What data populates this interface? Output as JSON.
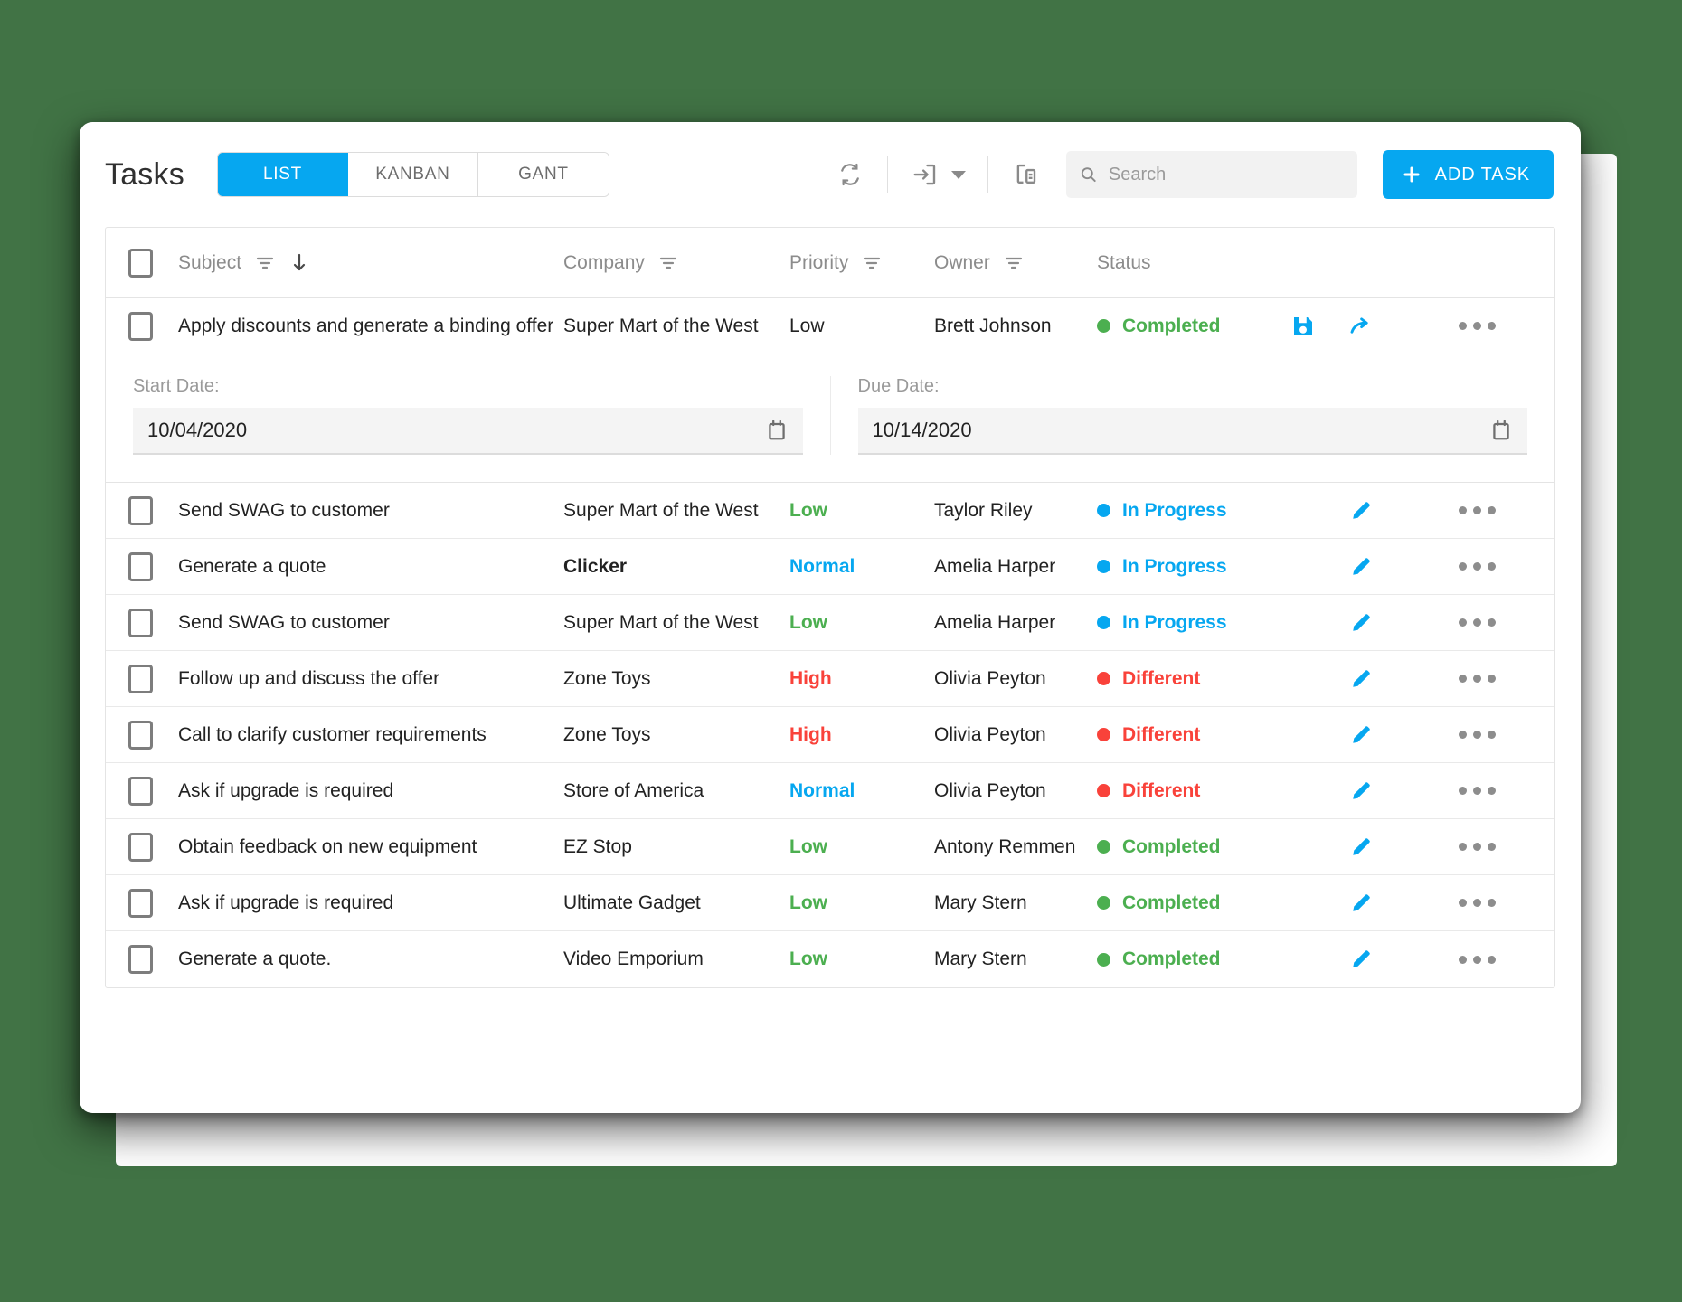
{
  "header": {
    "title": "Tasks",
    "views": [
      {
        "label": "LIST",
        "active": true
      },
      {
        "label": "KANBAN",
        "active": false
      },
      {
        "label": "GANT",
        "active": false
      }
    ],
    "actions": {
      "refresh_icon": "refresh-icon",
      "import_icon": "import-icon",
      "import_caret_icon": "chevron-down-icon",
      "document_icon": "document-settings-icon"
    },
    "search": {
      "placeholder": "Search",
      "value": "",
      "icon": "search-icon"
    },
    "add_task": {
      "label": "ADD TASK",
      "icon": "plus-icon"
    }
  },
  "grid": {
    "columns": [
      {
        "key": "subject",
        "label": "Subject",
        "filter": true,
        "sort": "desc"
      },
      {
        "key": "company",
        "label": "Company",
        "filter": true,
        "sort": null
      },
      {
        "key": "priority",
        "label": "Priority",
        "filter": true,
        "sort": null
      },
      {
        "key": "owner",
        "label": "Owner",
        "filter": true,
        "sort": null
      },
      {
        "key": "status",
        "label": "Status",
        "filter": false,
        "sort": null
      }
    ],
    "edit_panel": {
      "start_date": {
        "label": "Start Date:",
        "value": "10/04/2020"
      },
      "due_date": {
        "label": "Due Date:",
        "value": "10/14/2020"
      }
    },
    "rows": [
      {
        "subject": "Apply discounts and generate a binding offer",
        "company": "Super Mart of the West",
        "company_bold": false,
        "priority": "Low",
        "priority_color": "#222222",
        "priority_plain": true,
        "owner": "Brett Johnson",
        "status": "Completed",
        "status_color": "#4caf50",
        "editing": true
      },
      {
        "subject": "Send SWAG to customer",
        "company": "Super Mart of the West",
        "company_bold": false,
        "priority": "Low",
        "priority_color": "#4caf50",
        "priority_plain": false,
        "owner": "Taylor Riley",
        "status": "In Progress",
        "status_color": "#06a7f0",
        "editing": false
      },
      {
        "subject": "Generate a quote",
        "company": "Clicker",
        "company_bold": true,
        "priority": "Normal",
        "priority_color": "#06a7f0",
        "priority_plain": false,
        "owner": "Amelia Harper",
        "status": "In Progress",
        "status_color": "#06a7f0",
        "editing": false
      },
      {
        "subject": "Send SWAG to customer",
        "company": "Super Mart of the West",
        "company_bold": false,
        "priority": "Low",
        "priority_color": "#4caf50",
        "priority_plain": false,
        "owner": "Amelia Harper",
        "status": "In Progress",
        "status_color": "#06a7f0",
        "editing": false
      },
      {
        "subject": "Follow up and discuss the offer",
        "company": "Zone Toys",
        "company_bold": false,
        "priority": "High",
        "priority_color": "#f9423a",
        "priority_plain": false,
        "owner": "Olivia Peyton",
        "status": "Different",
        "status_color": "#f9423a",
        "editing": false
      },
      {
        "subject": "Call to clarify customer requirements",
        "company": "Zone Toys",
        "company_bold": false,
        "priority": "High",
        "priority_color": "#f9423a",
        "priority_plain": false,
        "owner": "Olivia Peyton",
        "status": "Different",
        "status_color": "#f9423a",
        "editing": false
      },
      {
        "subject": "Ask if upgrade is required",
        "company": "Store of America",
        "company_bold": false,
        "priority": "Normal",
        "priority_color": "#06a7f0",
        "priority_plain": false,
        "owner": "Olivia Peyton",
        "status": "Different",
        "status_color": "#f9423a",
        "editing": false
      },
      {
        "subject": "Obtain feedback on new equipment",
        "company": "EZ Stop",
        "company_bold": false,
        "priority": "Low",
        "priority_color": "#4caf50",
        "priority_plain": false,
        "owner": "Antony Remmen",
        "status": "Completed",
        "status_color": "#4caf50",
        "editing": false
      },
      {
        "subject": "Ask if upgrade is required",
        "company": "Ultimate Gadget",
        "company_bold": false,
        "priority": "Low",
        "priority_color": "#4caf50",
        "priority_plain": false,
        "owner": "Mary Stern",
        "status": "Completed",
        "status_color": "#4caf50",
        "editing": false
      },
      {
        "subject": "Generate a quote.",
        "company": "Video Emporium",
        "company_bold": false,
        "priority": "Low",
        "priority_color": "#4caf50",
        "priority_plain": false,
        "owner": "Mary Stern",
        "status": "Completed",
        "status_color": "#4caf50",
        "editing": false
      }
    ],
    "row_actions": {
      "save_icon": "save-icon",
      "revert_icon": "redo-arrow-icon",
      "edit_icon": "pencil-edit-icon",
      "more_icon": "more-options-icon"
    }
  },
  "theme": {
    "accent": "#06a7f0",
    "background": "#417345",
    "green": "#4caf50",
    "red": "#f9423a"
  }
}
